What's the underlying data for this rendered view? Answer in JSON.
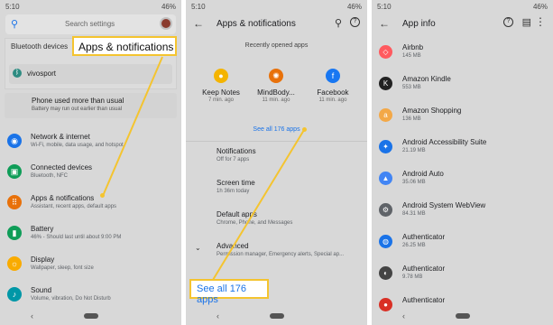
{
  "panel1": {
    "status": {
      "time": "5:10",
      "battery": "46%"
    },
    "search_placeholder": "Search settings",
    "bt_header": "Bluetooth devices",
    "bt_device": "vivosport",
    "warn_title": "Phone used more than usual",
    "warn_sub": "Battery may run out earlier than usual",
    "rows": [
      {
        "title": "Network & internet",
        "sub": "Wi-Fi, mobile, data usage, and hotspot",
        "icon": "wifi-icon",
        "color": "#1a73e8",
        "glyph": "◉"
      },
      {
        "title": "Connected devices",
        "sub": "Bluetooth, NFC",
        "icon": "devices-icon",
        "color": "#0f9d58",
        "glyph": "▣"
      },
      {
        "title": "Apps & notifications",
        "sub": "Assistant, recent apps, default apps",
        "icon": "apps-icon",
        "color": "#e8710a",
        "glyph": "⠿"
      },
      {
        "title": "Battery",
        "sub": "46% - Should last until about 9:00 PM",
        "icon": "battery-icon",
        "color": "#0f9d58",
        "glyph": "▮"
      },
      {
        "title": "Display",
        "sub": "Wallpaper, sleep, font size",
        "icon": "display-icon",
        "color": "#f9ab00",
        "glyph": "☼"
      },
      {
        "title": "Sound",
        "sub": "Volume, vibration, Do Not Disturb",
        "icon": "sound-icon",
        "color": "#0097a7",
        "glyph": "♪"
      }
    ],
    "callout": "Apps & notifications"
  },
  "panel2": {
    "status": {
      "time": "5:10",
      "battery": "46%"
    },
    "title": "Apps & notifications",
    "recent_header": "Recently opened apps",
    "recent": [
      {
        "name": "Keep Notes",
        "time": "7 min. ago",
        "icon": "keep-notes-icon",
        "color": "#f4b400",
        "glyph": "●"
      },
      {
        "name": "MindBody...",
        "time": "11 min. ago",
        "icon": "mindbody-icon",
        "color": "#e8710a",
        "glyph": "✺"
      },
      {
        "name": "Facebook",
        "time": "11 min. ago",
        "icon": "facebook-icon",
        "color": "#1877f2",
        "glyph": "f"
      }
    ],
    "see_all": "See all 176 apps",
    "rows": [
      {
        "title": "Notifications",
        "sub": "Off for 7 apps"
      },
      {
        "title": "Screen time",
        "sub": "1h 36m today"
      },
      {
        "title": "Default apps",
        "sub": "Chrome, Phone, and Messages"
      },
      {
        "title": "Advanced",
        "sub": "Permission manager, Emergency alerts, Special ap..."
      }
    ],
    "callout": "See all 176 apps"
  },
  "panel3": {
    "status": {
      "time": "5:10",
      "battery": "46%"
    },
    "title": "App info",
    "apps": [
      {
        "name": "Airbnb",
        "size": "145 MB",
        "icon": "airbnb-icon",
        "color": "#ff5a5f",
        "glyph": "◇"
      },
      {
        "name": "Amazon Kindle",
        "size": "553 MB",
        "icon": "kindle-icon",
        "color": "#222222",
        "glyph": "K"
      },
      {
        "name": "Amazon Shopping",
        "size": "136 MB",
        "icon": "amazon-icon",
        "color": "#f3a847",
        "glyph": "a"
      },
      {
        "name": "Android Accessibility Suite",
        "size": "21.19 MB",
        "icon": "accessibility-icon",
        "color": "#1a73e8",
        "glyph": "✦"
      },
      {
        "name": "Android Auto",
        "size": "35.06 MB",
        "icon": "android-auto-icon",
        "color": "#4285f4",
        "glyph": "▲"
      },
      {
        "name": "Android System WebView",
        "size": "84.31 MB",
        "icon": "webview-icon",
        "color": "#5f6368",
        "glyph": "⚙"
      },
      {
        "name": "Authenticator",
        "size": "26.25 MB",
        "icon": "authenticator-icon",
        "color": "#1a73e8",
        "glyph": "◍"
      },
      {
        "name": "Authenticator",
        "size": "9.78 MB",
        "icon": "authenticator-icon",
        "color": "#444444",
        "glyph": "◐"
      },
      {
        "name": "Authenticator",
        "size": "",
        "icon": "authenticator-icon",
        "color": "#d93025",
        "glyph": "●"
      }
    ]
  }
}
